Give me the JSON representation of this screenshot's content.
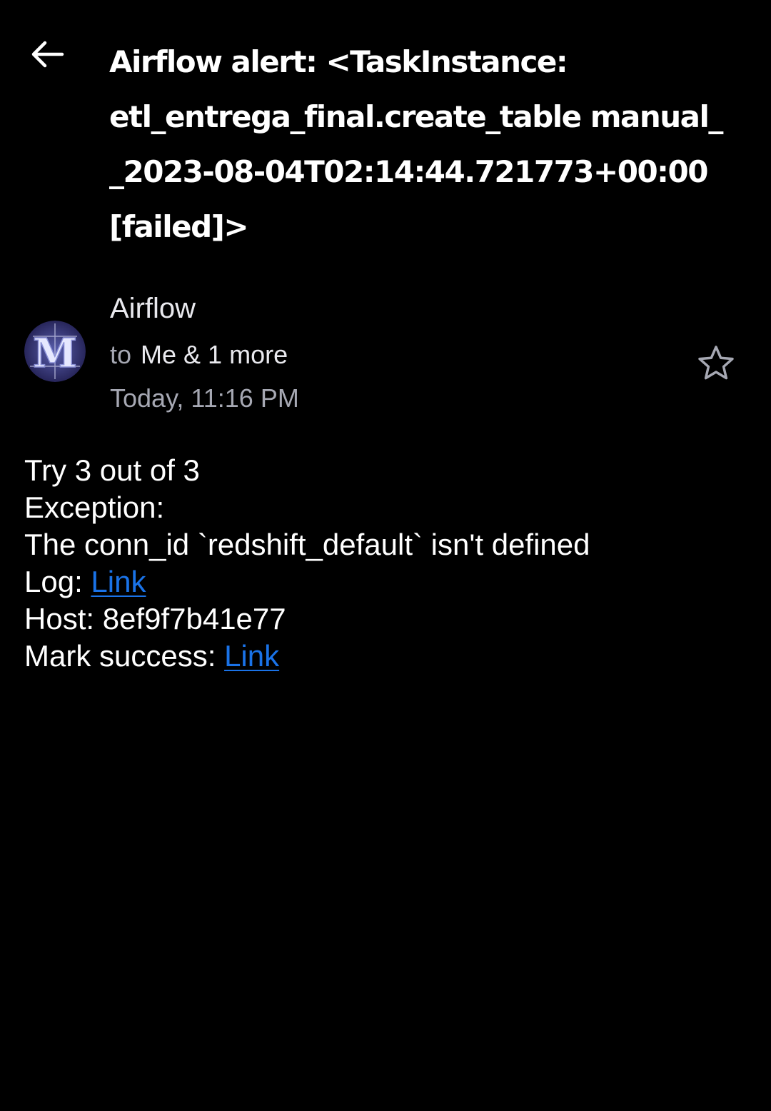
{
  "header": {
    "back_icon": "arrow-left-icon"
  },
  "email": {
    "subject_lines": [
      "Airflow alert: <TaskInstance:",
      "etl_entrega_final.create_table manual_",
      "_2023-08-04T02:14:44.721773+00:00",
      "[failed]>"
    ],
    "sender": {
      "name": "Airflow",
      "avatar_letter": "M",
      "avatar_colors": [
        "#2b2b6e",
        "#8fa0d8",
        "#ffffff"
      ]
    },
    "recipients": {
      "to_label": "to",
      "value": "Me & 1 more"
    },
    "date": "Today, 11:16 PM",
    "star_icon": "star-outline-icon",
    "body": {
      "try_line": "Try 3 out of 3",
      "exception_label": "Exception:",
      "exception_text": "The conn_id `redshift_default` isn't defined",
      "log_label": "Log: ",
      "log_link": "Link",
      "host_label": "Host: ",
      "host_value": "8ef9f7b41e77",
      "mark_success_label": "Mark success: ",
      "mark_success_link": "Link"
    }
  },
  "colors": {
    "background": "#000000",
    "text": "#ffffff",
    "muted": "#a6a8b3",
    "link": "#1a73e8"
  }
}
